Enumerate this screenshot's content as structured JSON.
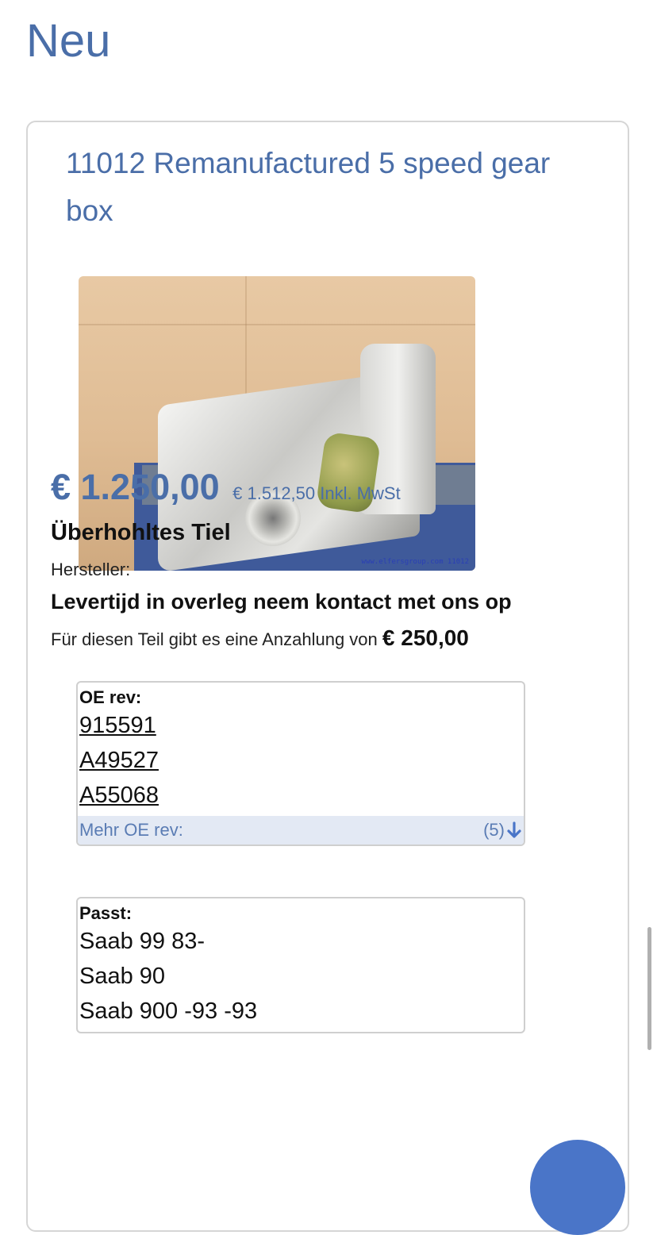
{
  "section": {
    "title": "Neu"
  },
  "product": {
    "title": "11012 Remanufactured 5 speed gear box",
    "image_alt": "Remanufactured gearbox photo",
    "watermark": "www.elfersgroup.com 11012",
    "price": "€ 1.250,00",
    "price_incl": "€ 1.512,50 Inkl. MwSt",
    "condition": "Überhohltes Tiel",
    "manufacturer_label": "Hersteller:",
    "delivery": "Levertijd in overleg neem kontact met ons op",
    "deposit_text": "Für diesen Teil gibt es eine Anzahlung von",
    "deposit_amount": "€ 250,00"
  },
  "oe_box": {
    "label": "OE rev:",
    "items": [
      "915591",
      "A49527",
      "A55068"
    ],
    "more_label": "Mehr OE rev:",
    "more_count": "(5)"
  },
  "fit_box": {
    "label": "Passt:",
    "items": [
      "Saab 99 83-",
      "Saab 90",
      "Saab 900 -93 -93"
    ]
  },
  "colors": {
    "accent": "#4a6ea8",
    "more_bg": "#e3e9f4",
    "fab": "#4a75c8"
  },
  "icons": {
    "more_arrow": "arrow-down-icon"
  }
}
